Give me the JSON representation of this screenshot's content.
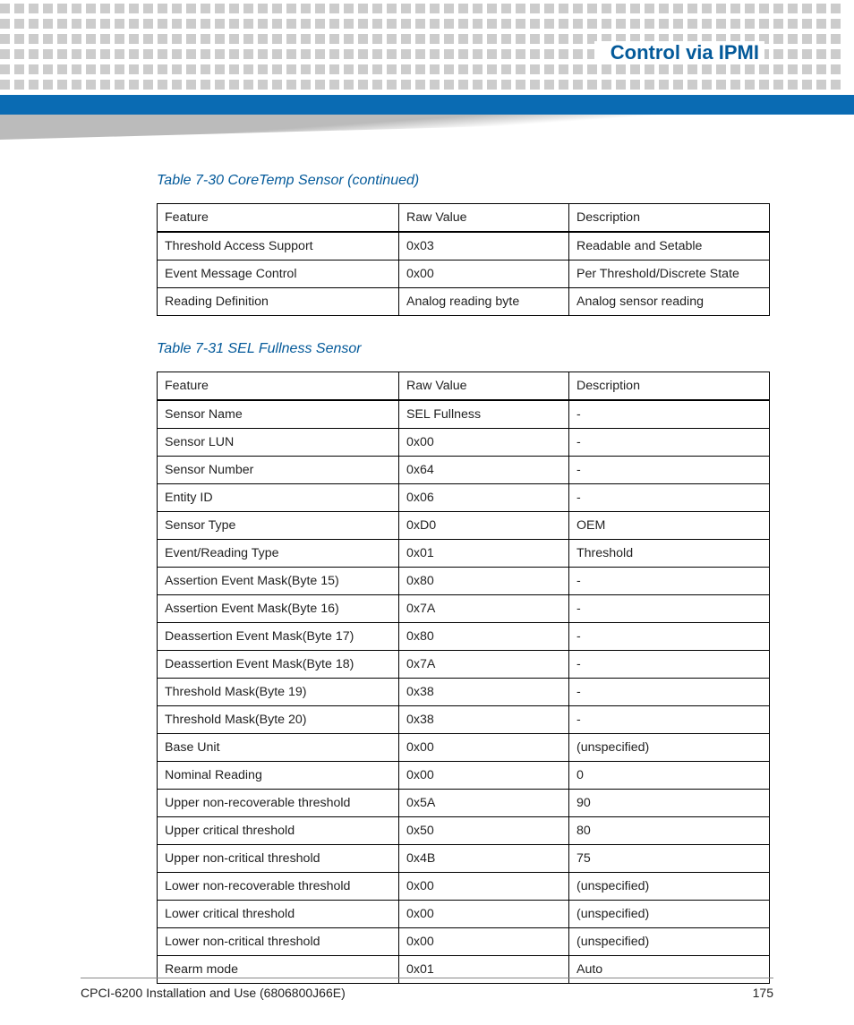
{
  "header": {
    "chapter_title": "Control via IPMI"
  },
  "table1": {
    "caption": "Table 7-30 CoreTemp Sensor (continued)",
    "cols": [
      "Feature",
      "Raw Value",
      "Description"
    ],
    "rows": [
      [
        "Threshold Access Support",
        "0x03",
        "Readable and Setable"
      ],
      [
        "Event Message Control",
        "0x00",
        "Per Threshold/Discrete State"
      ],
      [
        "Reading Definition",
        "Analog reading byte",
        "Analog sensor reading"
      ]
    ]
  },
  "table2": {
    "caption": "Table 7-31 SEL Fullness Sensor",
    "cols": [
      "Feature",
      "Raw Value",
      "Description"
    ],
    "rows": [
      [
        "Sensor Name",
        "SEL Fullness",
        "-"
      ],
      [
        "Sensor LUN",
        "0x00",
        "-"
      ],
      [
        "Sensor Number",
        "0x64",
        "-"
      ],
      [
        "Entity ID",
        "0x06",
        "-"
      ],
      [
        "Sensor Type",
        "0xD0",
        "OEM"
      ],
      [
        "Event/Reading Type",
        "0x01",
        "Threshold"
      ],
      [
        "Assertion Event Mask(Byte 15)",
        "0x80",
        "-"
      ],
      [
        "Assertion Event Mask(Byte 16)",
        "0x7A",
        "-"
      ],
      [
        "Deassertion Event Mask(Byte 17)",
        "0x80",
        "-"
      ],
      [
        "Deassertion Event Mask(Byte 18)",
        "0x7A",
        "-"
      ],
      [
        "Threshold Mask(Byte 19)",
        "0x38",
        "-"
      ],
      [
        "Threshold Mask(Byte 20)",
        "0x38",
        "-"
      ],
      [
        "Base Unit",
        "0x00",
        "(unspecified)"
      ],
      [
        "Nominal Reading",
        "0x00",
        "0"
      ],
      [
        "Upper non-recoverable threshold",
        "0x5A",
        "90"
      ],
      [
        "Upper critical threshold",
        "0x50",
        "80"
      ],
      [
        "Upper non-critical threshold",
        "0x4B",
        "75"
      ],
      [
        "Lower non-recoverable threshold",
        "0x00",
        "(unspecified)"
      ],
      [
        "Lower critical threshold",
        "0x00",
        "(unspecified)"
      ],
      [
        "Lower non-critical threshold",
        "0x00",
        "(unspecified)"
      ],
      [
        "Rearm mode",
        "0x01",
        "Auto"
      ]
    ]
  },
  "footer": {
    "doc": "CPCI-6200 Installation and Use (6806800J66E)",
    "page": "175"
  }
}
